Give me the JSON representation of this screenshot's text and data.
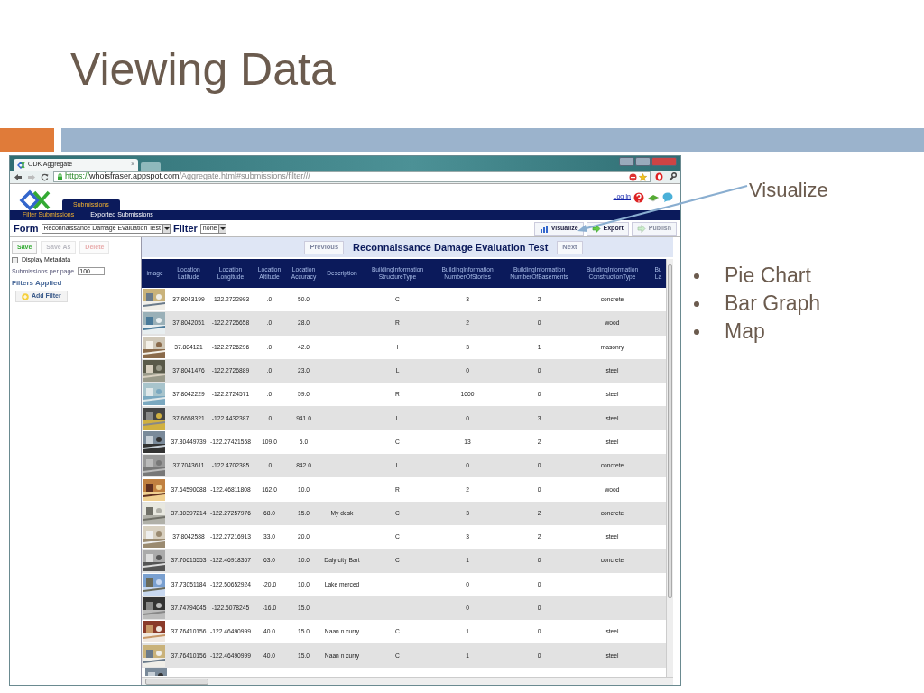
{
  "slide": {
    "title": "Viewing Data",
    "callout": "Visualize",
    "bullets": [
      "Pie Chart",
      "Bar Graph",
      "Map"
    ]
  },
  "browser": {
    "tab": {
      "title": "ODK Aggregate",
      "close": "×"
    },
    "url": {
      "scheme": "https://",
      "host": "whoisfraser.appspot.com",
      "path": "/Aggregate.html#submissions/filter///"
    }
  },
  "app": {
    "main_tabs": [
      {
        "label": "Submissions",
        "selected": true
      }
    ],
    "login": "Log In",
    "sub_tabs": [
      {
        "label": "Filter Submissions",
        "selected": true
      },
      {
        "label": "Exported Submissions",
        "selected": false
      }
    ],
    "form_label": "Form",
    "form_value": "Reconnaissance Damage Evaluation Test",
    "filter_label": "Filter",
    "filter_value": "none",
    "actions": [
      {
        "kind": "visualize",
        "label": "Visualize",
        "disabled": false
      },
      {
        "kind": "export",
        "label": "Export",
        "disabled": false
      },
      {
        "kind": "publish",
        "label": "Publish",
        "disabled": true
      }
    ],
    "filter_buttons": [
      {
        "kind": "save",
        "label": "Save",
        "disabled": false
      },
      {
        "kind": "saveas",
        "label": "Save As",
        "disabled": true
      },
      {
        "kind": "delete",
        "label": "Delete",
        "disabled": true
      }
    ],
    "display_metadata": {
      "label": "Display Metadata",
      "checked": false
    },
    "per_page": {
      "label": "Submissions per page",
      "value": "100"
    },
    "filters_heading": "Filters Applied",
    "add_filter": "Add Filter",
    "table": {
      "title": "Reconnaissance Damage Evaluation Test",
      "previous": {
        "label": "Previous",
        "disabled": true
      },
      "next": {
        "label": "Next",
        "disabled": true
      },
      "columns": [
        "image",
        "Location Latitude",
        "Location Longitude",
        "Location Altitude",
        "Location Accuracy",
        "Description",
        "BuildingInformation StructureType",
        "BuildingInformation NumberOfStories",
        "BuildingInformation NumberOfBasements",
        "BuildingInformation ConstructionType",
        "Bu La"
      ],
      "rows": [
        {
          "lat": "37.8043199",
          "lon": "-122.2722993",
          "alt": ".0",
          "acc": "50.0",
          "structure": "C",
          "stories": "3",
          "basements": "2",
          "construction": "concrete"
        },
        {
          "lat": "37.8042051",
          "lon": "-122.2726658",
          "alt": ".0",
          "acc": "28.0",
          "structure": "R",
          "stories": "2",
          "basements": "0",
          "construction": "wood"
        },
        {
          "lat": "37.804121",
          "lon": "-122.2726296",
          "alt": ".0",
          "acc": "42.0",
          "structure": "I",
          "stories": "3",
          "basements": "1",
          "construction": "masonry"
        },
        {
          "lat": "37.8041476",
          "lon": "-122.2726889",
          "alt": ".0",
          "acc": "23.0",
          "structure": "L",
          "stories": "0",
          "basements": "0",
          "construction": "steel"
        },
        {
          "lat": "37.8042229",
          "lon": "-122.2724571",
          "alt": ".0",
          "acc": "59.0",
          "structure": "R",
          "stories": "1000",
          "basements": "0",
          "construction": "steel"
        },
        {
          "lat": "37.6658321",
          "lon": "-122.4432387",
          "alt": ".0",
          "acc": "941.0",
          "structure": "L",
          "stories": "0",
          "basements": "3",
          "construction": "steel"
        },
        {
          "lat": "37.80449739",
          "lon": "-122.27421558",
          "alt": "109.0",
          "acc": "5.0",
          "structure": "C",
          "stories": "13",
          "basements": "2",
          "construction": "steel"
        },
        {
          "lat": "37.7043611",
          "lon": "-122.4702385",
          "alt": ".0",
          "acc": "842.0",
          "structure": "L",
          "stories": "0",
          "basements": "0",
          "construction": "concrete"
        },
        {
          "lat": "37.64590088",
          "lon": "-122.46811808",
          "alt": "162.0",
          "acc": "10.0",
          "structure": "R",
          "stories": "2",
          "basements": "0",
          "construction": "wood"
        },
        {
          "lat": "37.80397214",
          "lon": "-122.27257976",
          "alt": "68.0",
          "acc": "15.0",
          "desc": "My desk",
          "structure": "C",
          "stories": "3",
          "basements": "2",
          "construction": "concrete"
        },
        {
          "lat": "37.8042588",
          "lon": "-122.27216913",
          "alt": "33.0",
          "acc": "20.0",
          "structure": "C",
          "stories": "3",
          "basements": "2",
          "construction": "steel"
        },
        {
          "lat": "37.70615553",
          "lon": "-122.46918367",
          "alt": "63.0",
          "acc": "10.0",
          "desc": "Daly city Bart",
          "structure": "C",
          "stories": "1",
          "basements": "0",
          "construction": "concrete"
        },
        {
          "lat": "37.73051184",
          "lon": "-122.50652924",
          "alt": "-20.0",
          "acc": "10.0",
          "desc": "Lake merced",
          "stories": "0",
          "basements": "0"
        },
        {
          "lat": "37.74794045",
          "lon": "-122.5078245",
          "alt": "-16.0",
          "acc": "15.0",
          "stories": "0",
          "basements": "0"
        },
        {
          "lat": "37.76410156",
          "lon": "-122.46490999",
          "alt": "40.0",
          "acc": "15.0",
          "desc": "Naan n curry",
          "structure": "C",
          "stories": "1",
          "basements": "0",
          "construction": "steel"
        },
        {
          "lat": "37.76410156",
          "lon": "-122.46490999",
          "alt": "40.0",
          "acc": "15.0",
          "desc": "Naan n curry",
          "structure": "C",
          "stories": "1",
          "basements": "0",
          "construction": "steel"
        }
      ]
    }
  }
}
